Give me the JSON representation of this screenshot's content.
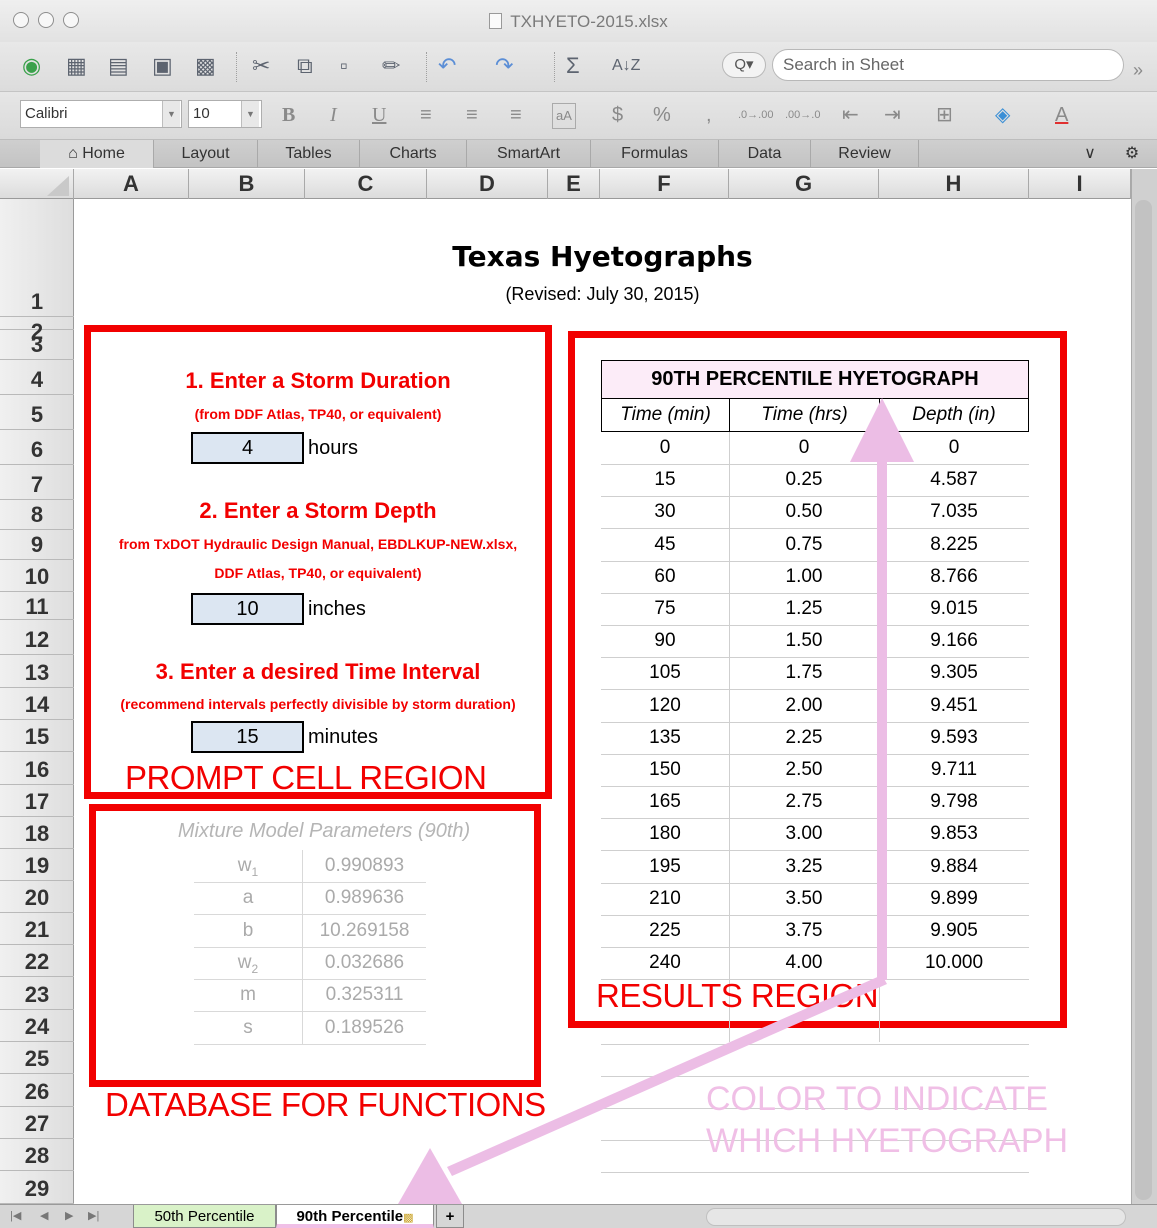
{
  "window": {
    "title": "TXHYETO-2015.xlsx"
  },
  "toolbar": {
    "search_placeholder": "Search in Sheet",
    "overflow": "»",
    "search_dd": "Q▾"
  },
  "formatting": {
    "font": "Calibri",
    "size": "10",
    "bold": "B",
    "italic": "I",
    "underline": "U",
    "currency": "$",
    "percent": "%",
    "comma": ",",
    "inc_dec": ".0→.00",
    "dec_dec": ".00→.0"
  },
  "ribbon": {
    "tabs": [
      "Home",
      "Layout",
      "Tables",
      "Charts",
      "SmartArt",
      "Formulas",
      "Data",
      "Review"
    ]
  },
  "columns": [
    "A",
    "B",
    "C",
    "D",
    "E",
    "F",
    "G",
    "H",
    "I"
  ],
  "rows": [
    "1",
    "2",
    "3",
    "4",
    "5",
    "6",
    "7",
    "8",
    "9",
    "10",
    "11",
    "12",
    "13",
    "14",
    "15",
    "16",
    "17",
    "18",
    "19",
    "20",
    "21",
    "22",
    "23",
    "24",
    "25",
    "26",
    "27",
    "28",
    "29"
  ],
  "sheet": {
    "title": "Texas Hyetographs",
    "subtitle": "(Revised: July 30, 2015)",
    "prompts": [
      {
        "heading": "1.  Enter a Storm Duration",
        "sub": "(from DDF Atlas, TP40, or equivalent)",
        "sub2": "",
        "value": "4",
        "unit": "hours"
      },
      {
        "heading": "2.  Enter a Storm Depth",
        "sub": "from TxDOT Hydraulic Design Manual, EBDLKUP-NEW.xlsx,",
        "sub2": "DDF Atlas, TP40, or equivalent)",
        "value": "10",
        "unit": "inches"
      },
      {
        "heading": "3. Enter a desired Time Interval",
        "sub": "(recommend intervals perfectly divisible by storm duration)",
        "sub2": "",
        "value": "15",
        "unit": "minutes"
      }
    ],
    "results": {
      "header": "90TH PERCENTILE HYETOGRAPH",
      "columns": [
        "Time (min)",
        "Time (hrs)",
        "Depth (in)"
      ],
      "rows": [
        [
          "0",
          "0",
          "0"
        ],
        [
          "15",
          "0.25",
          "4.587"
        ],
        [
          "30",
          "0.50",
          "7.035"
        ],
        [
          "45",
          "0.75",
          "8.225"
        ],
        [
          "60",
          "1.00",
          "8.766"
        ],
        [
          "75",
          "1.25",
          "9.015"
        ],
        [
          "90",
          "1.50",
          "9.166"
        ],
        [
          "105",
          "1.75",
          "9.305"
        ],
        [
          "120",
          "2.00",
          "9.451"
        ],
        [
          "135",
          "2.25",
          "9.593"
        ],
        [
          "150",
          "2.50",
          "9.711"
        ],
        [
          "165",
          "2.75",
          "9.798"
        ],
        [
          "180",
          "3.00",
          "9.853"
        ],
        [
          "195",
          "3.25",
          "9.884"
        ],
        [
          "210",
          "3.50",
          "9.899"
        ],
        [
          "225",
          "3.75",
          "9.905"
        ],
        [
          "240",
          "4.00",
          "10.000"
        ]
      ]
    },
    "parameters": {
      "title": "Mixture Model Parameters (90th)",
      "rows": [
        {
          "name": "w",
          "sub": "1",
          "value": "0.990893"
        },
        {
          "name": "a",
          "sub": "",
          "value": "0.989636"
        },
        {
          "name": "b",
          "sub": "",
          "value": "10.269158"
        },
        {
          "name": "w",
          "sub": "2",
          "value": "0.032686"
        },
        {
          "name": "m",
          "sub": "",
          "value": "0.325311"
        },
        {
          "name": "s",
          "sub": "",
          "value": "0.189526"
        }
      ]
    }
  },
  "annotations": {
    "prompt_region": "PROMPT CELL REGION",
    "results_region": "RESULTS REGION",
    "database": "DATABASE FOR FUNCTIONS",
    "color_note_1": "COLOR TO INDICATE",
    "color_note_2": "WHICH HYETOGRAPH"
  },
  "sheet_tabs": [
    {
      "label": "50th Percentile",
      "color": "#d9f2c8"
    },
    {
      "label": "90th Percentile",
      "color": "#f0bfe6"
    }
  ],
  "colors": {
    "annotation_red": "#f20000",
    "annotation_pink": "#f0bfe6",
    "input_fill": "#dce6f2",
    "header_fill": "#fcecf8"
  }
}
